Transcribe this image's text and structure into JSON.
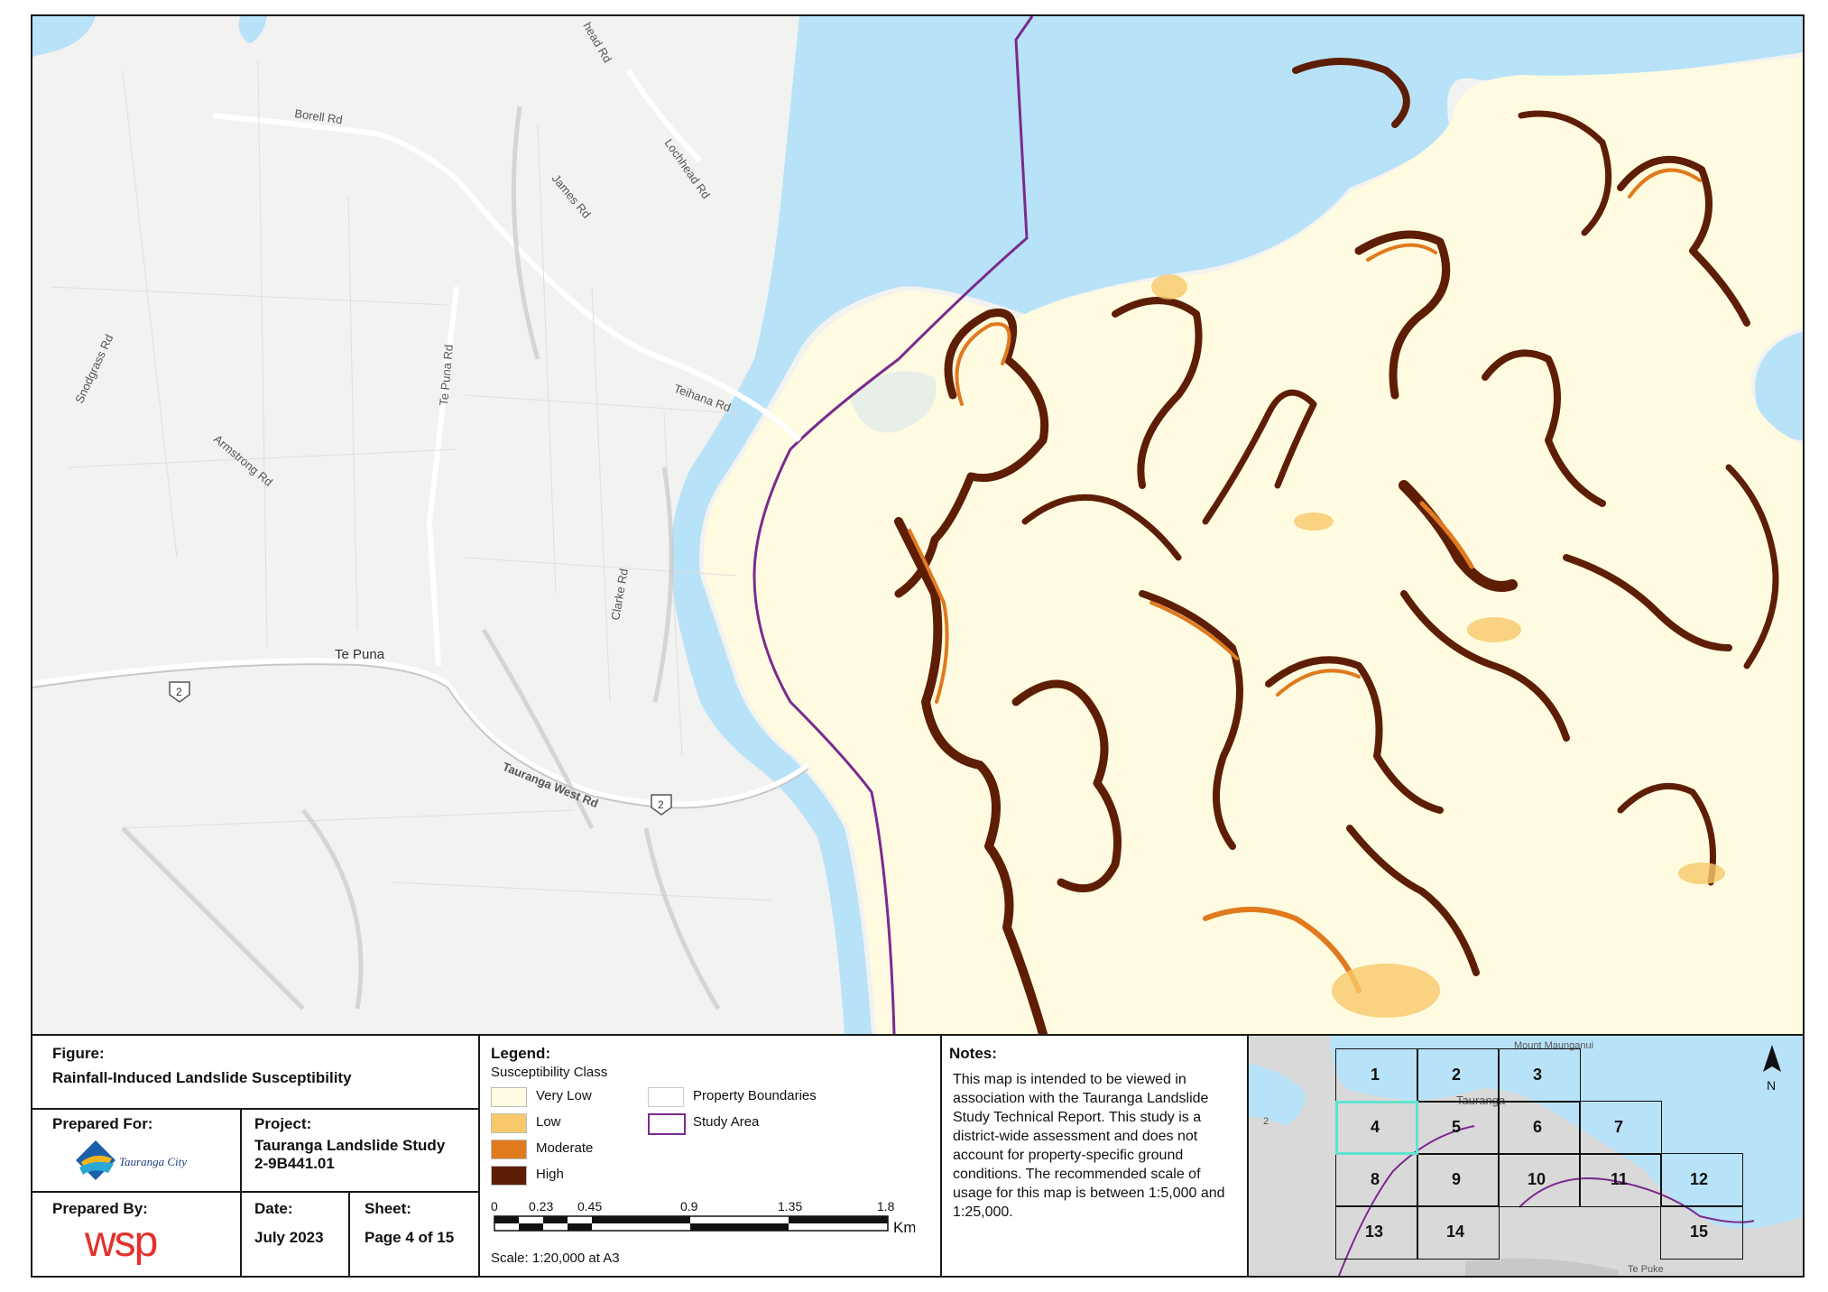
{
  "map": {
    "place_labels": [
      {
        "name": "Borell Rd"
      },
      {
        "name": "Lochhead Rd"
      },
      {
        "name": "James Rd"
      },
      {
        "name": "Snodgrass Rd"
      },
      {
        "name": "Te Puna Rd"
      },
      {
        "name": "Teihana Rd"
      },
      {
        "name": "Armstrong Rd"
      },
      {
        "name": "Clarke Rd"
      },
      {
        "name": "Te Puna"
      },
      {
        "name": "Tauranga West Rd"
      },
      {
        "name": "2"
      },
      {
        "name": "2"
      },
      {
        "name": "head Rd"
      }
    ],
    "colors": {
      "water": "#b8e2f8",
      "land": "#f2f2f0",
      "very_low": "#fffbe0",
      "low": "#f7c96a",
      "moderate": "#e07a1e",
      "high": "#5e1e06",
      "study_area": "#7b2a8e"
    }
  },
  "figure": {
    "label": "Figure:",
    "title": "Rainfall-Induced Landslide Susceptibility"
  },
  "prepared_for": {
    "label": "Prepared For:",
    "org": "Tauranga City"
  },
  "project": {
    "label": "Project:",
    "name": "Tauranga Landslide Study",
    "code": "2-9B441.01"
  },
  "prepared_by": {
    "label": "Prepared By:",
    "org": "wsp"
  },
  "date": {
    "label": "Date:",
    "value": "July 2023"
  },
  "sheet": {
    "label": "Sheet:",
    "value": "Page 4 of 15"
  },
  "legend": {
    "title": "Legend:",
    "subtitle": "Susceptibility Class",
    "classes": [
      {
        "label": "Very Low",
        "color": "#fffbe0"
      },
      {
        "label": "Low",
        "color": "#f7c96a"
      },
      {
        "label": "Moderate",
        "color": "#e07a1e"
      },
      {
        "label": "High",
        "color": "#5e1e06"
      }
    ],
    "other": [
      {
        "label": "Property Boundaries"
      },
      {
        "label": "Study Area",
        "color": "#7b2a8e"
      }
    ]
  },
  "scale": {
    "ticks": [
      "0",
      "0.23",
      "0.45",
      "0.9",
      "1.35",
      "1.8"
    ],
    "unit": "Km",
    "text": "Scale: 1:20,000 at A3"
  },
  "notes": {
    "label": "Notes:",
    "text": "This map is intended to be viewed in association with the Tauranga Landslide Study Technical Report. This study is a district-wide assessment and does not account for property-specific ground conditions. The recommended scale of usage for this map is between 1:5,000 and 1:25,000."
  },
  "inset": {
    "tiles": [
      "1",
      "2",
      "3",
      "4",
      "5",
      "6",
      "7",
      "8",
      "9",
      "10",
      "11",
      "12",
      "13",
      "14",
      "15"
    ],
    "current": "4",
    "labels": [
      "Mount Maunganui",
      "Tauranga",
      "Te Puke",
      "2"
    ],
    "north": "N"
  }
}
